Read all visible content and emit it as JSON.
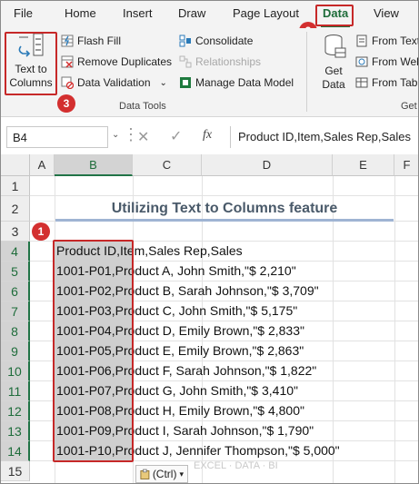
{
  "tabs": [
    "File",
    "Home",
    "Insert",
    "Draw",
    "Page Layout",
    "Data",
    "View"
  ],
  "ribbon": {
    "text_to_columns": "Text to Columns",
    "flash_fill": "Flash Fill",
    "remove_duplicates": "Remove Duplicates",
    "data_validation": "Data Validation",
    "consolidate": "Consolidate",
    "relationships": "Relationships",
    "manage_data_model": "Manage Data Model",
    "get_data": "Get Data",
    "from_text": "From Text",
    "from_web": "From Web",
    "from_table": "From Tabl",
    "group_data_tools": "Data Tools",
    "group_get": "Get"
  },
  "formula_bar": {
    "name_box": "B4",
    "fx": "fx",
    "formula": "Product ID,Item,Sales Rep,Sales"
  },
  "columns": [
    "A",
    "B",
    "C",
    "D",
    "E",
    "F"
  ],
  "rows": [
    "1",
    "2",
    "3",
    "4",
    "5",
    "6",
    "7",
    "8",
    "9",
    "10",
    "11",
    "12",
    "13",
    "14",
    "15"
  ],
  "sheet": {
    "title": "Utilizing Text to Columns feature",
    "cells": [
      "Product ID,Item,Sales Rep,Sales",
      "1001-P01,Product A, John Smith,\"$ 2,210\"",
      "1001-P02,Product B, Sarah Johnson,\"$ 3,709\"",
      "1001-P03,Product C, John Smith,\"$ 5,175\"",
      "1001-P04,Product D, Emily Brown,\"$ 2,833\"",
      "1001-P05,Product E, Emily Brown,\"$ 2,863\"",
      "1001-P06,Product F, Sarah Johnson,\"$ 1,822\"",
      "1001-P07,Product G, John Smith,\"$ 3,410\"",
      "1001-P08,Product H, Emily Brown,\"$ 4,800\"",
      "1001-P09,Product I, Sarah Johnson,\"$ 1,790\"",
      "1001-P10,Product J, Jennifer Thompson,\"$ 5,000\""
    ]
  },
  "badges": [
    "1",
    "2",
    "3"
  ],
  "paste_options": "(Ctrl)",
  "watermark": "EXCEL · DATA · BI",
  "colors": {
    "accent": "#217346",
    "highlight": "#c62828"
  }
}
